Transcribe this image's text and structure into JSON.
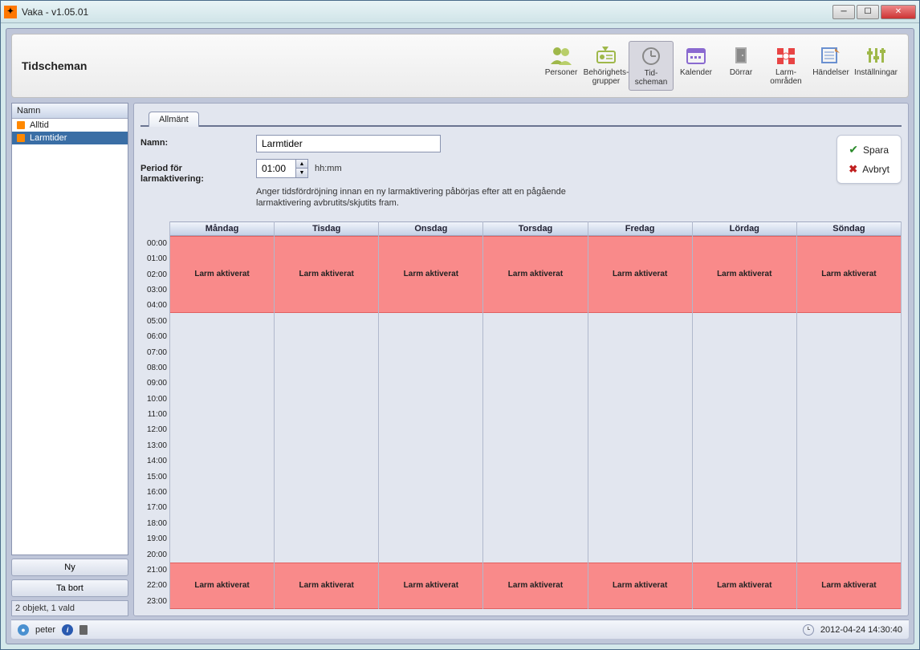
{
  "window": {
    "title": "Vaka - v1.05.01"
  },
  "header": {
    "page_title": "Tidscheman"
  },
  "toolbar": [
    {
      "id": "personer",
      "label": "Personer"
    },
    {
      "id": "behorighet",
      "label": "Behörighets-\ngrupper"
    },
    {
      "id": "tidscheman",
      "label": "Tid-\nscheman",
      "active": true
    },
    {
      "id": "kalender",
      "label": "Kalender"
    },
    {
      "id": "dorrar",
      "label": "Dörrar"
    },
    {
      "id": "larmomraden",
      "label": "Larm-\nområden"
    },
    {
      "id": "handelser",
      "label": "Händelser"
    },
    {
      "id": "installningar",
      "label": "Inställningar"
    }
  ],
  "sidebar": {
    "header": "Namn",
    "items": [
      {
        "label": "Alltid",
        "selected": false
      },
      {
        "label": "Larmtider",
        "selected": true
      }
    ],
    "btn_new": "Ny",
    "btn_delete": "Ta bort",
    "status": "2 objekt, 1 vald"
  },
  "tab": {
    "label": "Allmänt"
  },
  "form": {
    "name_label": "Namn:",
    "name_value": "Larmtider",
    "period_label": "Period för larmaktivering:",
    "period_value": "01:00",
    "hhmm": "hh:mm",
    "help": "Anger tidsfördröjning innan en ny larmaktivering påbörjas efter att en pågående larmaktivering avbrutits/skjutits fram."
  },
  "actions": {
    "save": "Spara",
    "cancel": "Avbryt"
  },
  "schedule": {
    "hours": [
      "00:00",
      "01:00",
      "02:00",
      "03:00",
      "04:00",
      "05:00",
      "06:00",
      "07:00",
      "08:00",
      "09:00",
      "10:00",
      "11:00",
      "12:00",
      "13:00",
      "14:00",
      "15:00",
      "16:00",
      "17:00",
      "18:00",
      "19:00",
      "20:00",
      "21:00",
      "22:00",
      "23:00"
    ],
    "days": [
      "Måndag",
      "Tisdag",
      "Onsdag",
      "Torsdag",
      "Fredag",
      "Lördag",
      "Söndag"
    ],
    "block_label": "Larm aktiverat",
    "blocks": [
      {
        "start_pct": 0,
        "height_pct": 20.8
      },
      {
        "start_pct": 87.5,
        "height_pct": 12.5
      }
    ]
  },
  "statusbar": {
    "user": "peter",
    "datetime": "2012-04-24 14:30:40"
  }
}
